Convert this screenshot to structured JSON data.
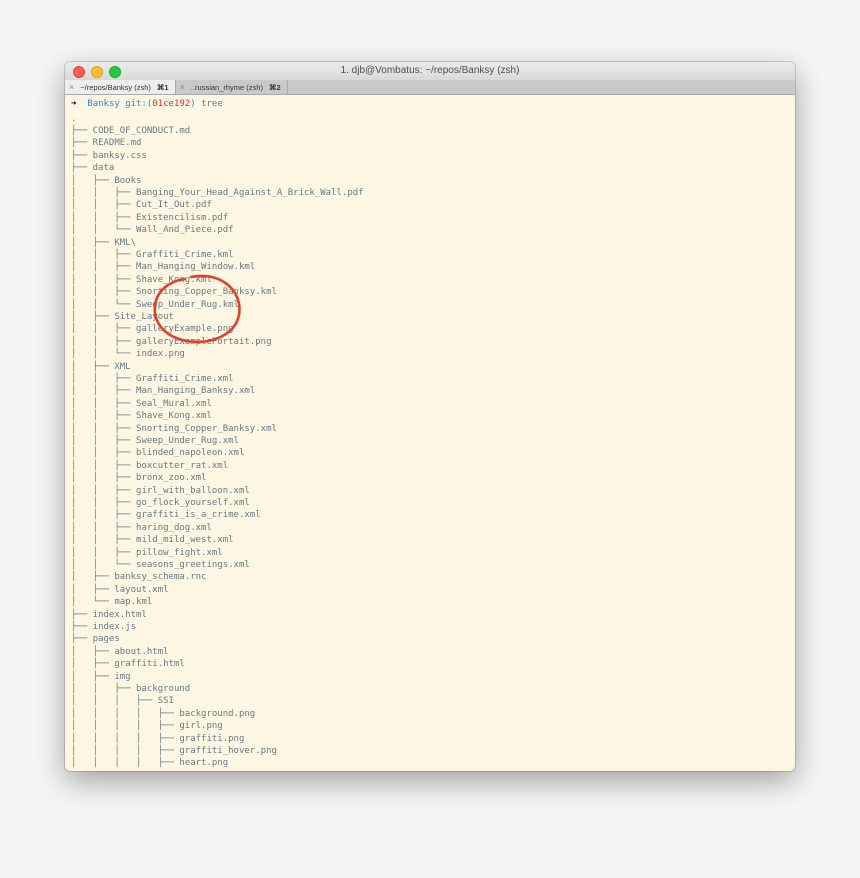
{
  "window": {
    "title": "1. djb@Vombatus: ~/repos/Banksy (zsh)",
    "tabs": [
      {
        "label": "~/repos/Banksy (zsh)",
        "shortcut": "⌘1",
        "active": true
      },
      {
        "label": "..russian_rhyme (zsh)",
        "shortcut": "⌘2",
        "active": false
      }
    ]
  },
  "prompt": {
    "arrow": "➜",
    "directory": "Banksy",
    "git_prefix": "git:(",
    "branch": "01ce192",
    "git_suffix": ")",
    "command": "tree"
  },
  "tree_lines": [
    ".",
    "├── CODE_OF_CONDUCT.md",
    "├── README.md",
    "├── banksy.css",
    "├── data",
    "│   ├── Books",
    "│   │   ├── Banging_Your_Head_Against_A_Brick_Wall.pdf",
    "│   │   ├── Cut_It_Out.pdf",
    "│   │   ├── Existencilism.pdf",
    "│   │   └── Wall_And_Piece.pdf",
    "│   ├── KML\\",
    "│   │   ├── Graffiti_Crime.kml",
    "│   │   ├── Man_Hanging_Window.kml",
    "│   │   ├── Shave_Kong.kml",
    "│   │   ├── Snorting_Copper_Banksy.kml",
    "│   │   └── Sweep_Under_Rug.kml",
    "│   ├── Site_Layout",
    "│   │   ├── galleryExample.png",
    "│   │   ├── galleryExamplePortait.png",
    "│   │   └── index.png",
    "│   ├── XML",
    "│   │   ├── Graffiti_Crime.xml",
    "│   │   ├── Man_Hanging_Banksy.xml",
    "│   │   ├── Seal_Mural.xml",
    "│   │   ├── Shave_Kong.xml",
    "│   │   ├── Snorting_Copper_Banksy.xml",
    "│   │   ├── Sweep_Under_Rug.xml",
    "│   │   ├── blinded_napoleon.xml",
    "│   │   ├── boxcutter_rat.xml",
    "│   │   ├── bronx_zoo.xml",
    "│   │   ├── girl_with_balloon.xml",
    "│   │   ├── go_flock_yourself.xml",
    "│   │   ├── graffiti_is_a_crime.xml",
    "│   │   ├── haring_dog.xml",
    "│   │   ├── mild_mild_west.xml",
    "│   │   ├── pillow_fight.xml",
    "│   │   └── seasons_greetings.xml",
    "│   ├── banksy_schema.rnc",
    "│   ├── layout.xml",
    "│   └── map.kml",
    "├── index.html",
    "├── index.js",
    "├── pages",
    "│   ├── about.html",
    "│   ├── graffiti.html",
    "│   ├── img",
    "│   │   ├── background",
    "│   │   │   ├── SSI",
    "│   │   │   │   ├── background.png",
    "│   │   │   │   ├── girl.png",
    "│   │   │   │   ├── graffiti.png",
    "│   │   │   │   ├── graffiti_hover.png",
    "│   │   │   │   ├── heart.png"
  ],
  "colors": {
    "terminal_bg": "#fdf6e3",
    "terminal_fg": "#657b83",
    "prompt_dir": "#268bd2",
    "prompt_branch": "#dc322f",
    "annotation": "#e0402a"
  }
}
